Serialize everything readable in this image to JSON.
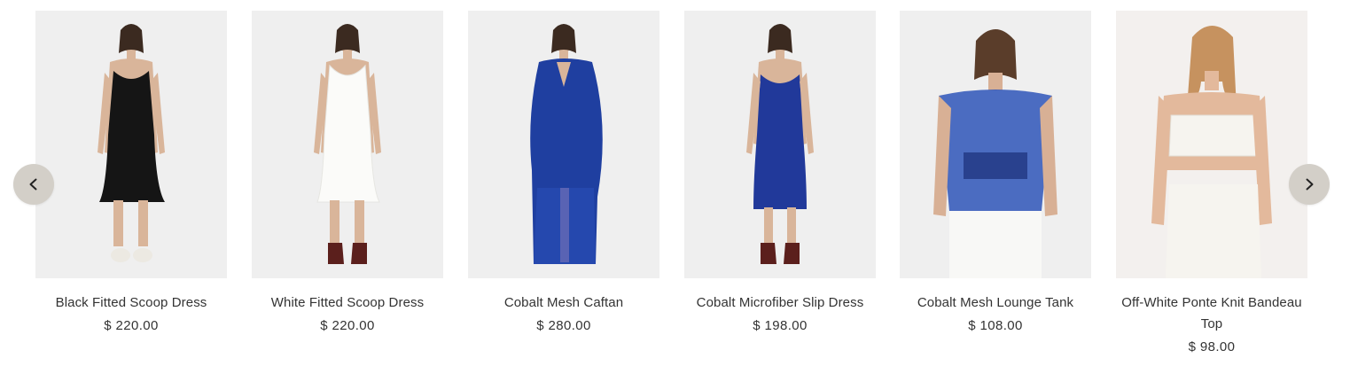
{
  "carousel": {
    "prev_icon": "chevron-left-icon",
    "next_icon": "chevron-right-icon",
    "products": [
      {
        "title": "Black Fitted Scoop Dress",
        "price": "$ 220.00",
        "garment_color": "#151515"
      },
      {
        "title": "White Fitted Scoop Dress",
        "price": "$ 220.00",
        "garment_color": "#f7f7f5"
      },
      {
        "title": "Cobalt Mesh Caftan",
        "price": "$ 280.00",
        "garment_color": "#1f3fa0"
      },
      {
        "title": "Cobalt Microfiber Slip Dress",
        "price": "$ 198.00",
        "garment_color": "#21399a"
      },
      {
        "title": "Cobalt Mesh Lounge Tank",
        "price": "$ 108.00",
        "garment_color": "#2e55b8"
      },
      {
        "title": "Off-White Ponte Knit Bandeau Top",
        "price": "$ 98.00",
        "garment_color": "#f6f4ef"
      }
    ]
  },
  "colors": {
    "arrow_bg": "#d3cfc8",
    "photo_bg": "#efefef",
    "text": "#333333"
  }
}
